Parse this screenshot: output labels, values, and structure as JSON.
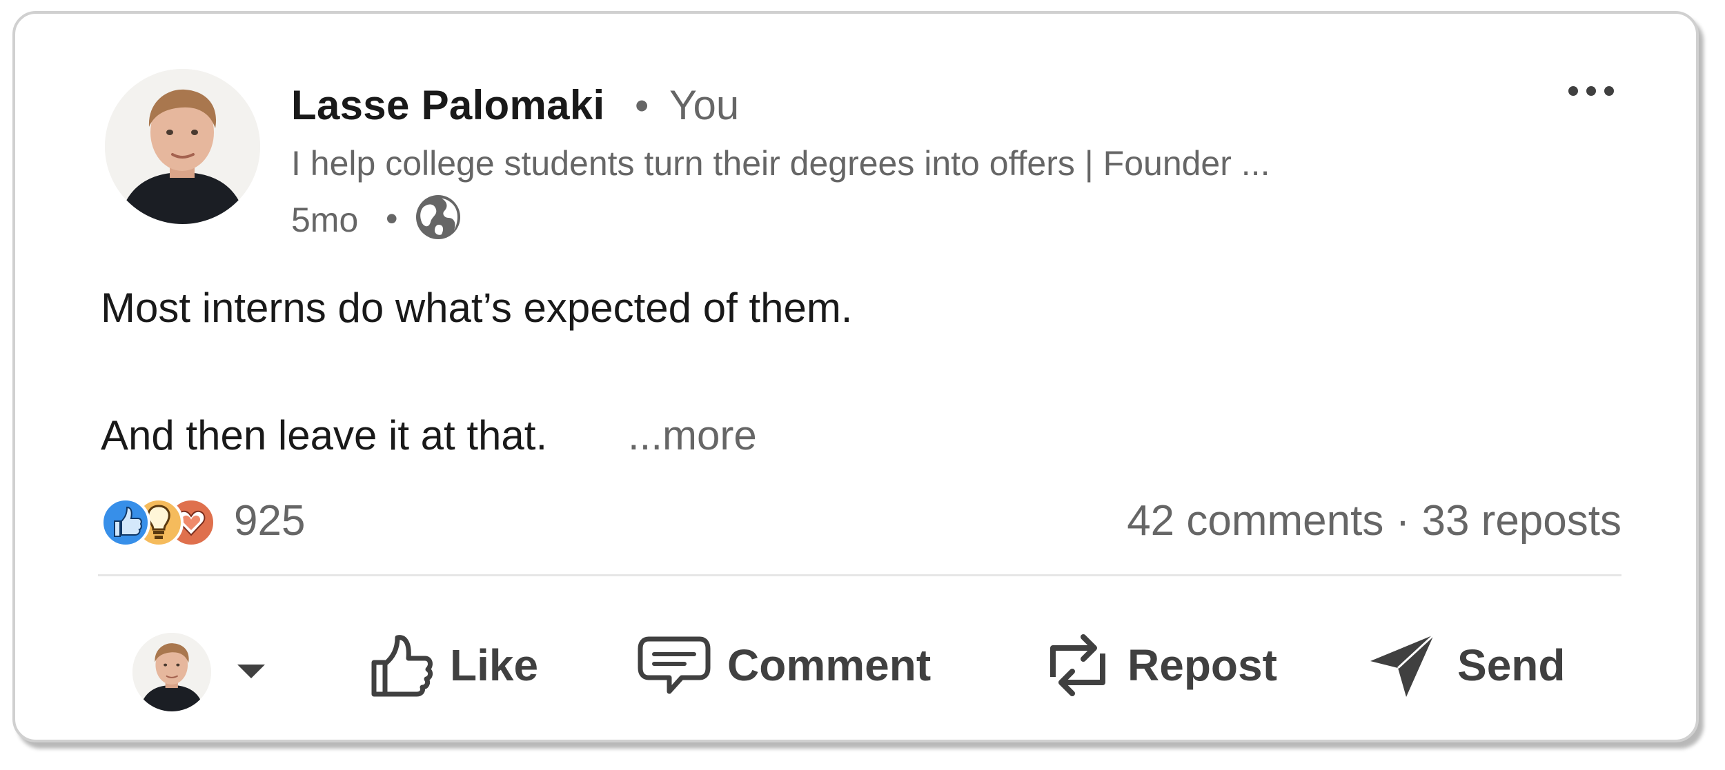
{
  "post": {
    "author": {
      "name": "Lasse Palomaki",
      "separator": "•",
      "relation": "You",
      "headline": "I help college students turn their degrees into offers | Founder ...",
      "time": "5mo",
      "time_separator": "•",
      "visibility_icon": "globe-icon"
    },
    "menu_icon": "more-horizontal-icon",
    "body": {
      "line1": "Most interns do what’s expected of them.",
      "line2": "And then leave it at that.",
      "see_more": "...more"
    },
    "social": {
      "reaction_icons": [
        "like-reaction-icon",
        "insightful-reaction-icon",
        "love-reaction-icon"
      ],
      "reaction_count": "925",
      "comments": "42 comments",
      "separator": "·",
      "reposts": "33 reposts"
    },
    "actions": {
      "actor_icon": "chevron-down-icon",
      "like": "Like",
      "comment": "Comment",
      "repost": "Repost",
      "send": "Send"
    }
  },
  "colors": {
    "primary_text": "#191919",
    "secondary_text": "#666666",
    "action_text": "#404040",
    "like_blue": "#378fe9",
    "insight_yellow": "#f5bb5c",
    "love_red": "#df704d",
    "divider": "#e6e6e6"
  }
}
